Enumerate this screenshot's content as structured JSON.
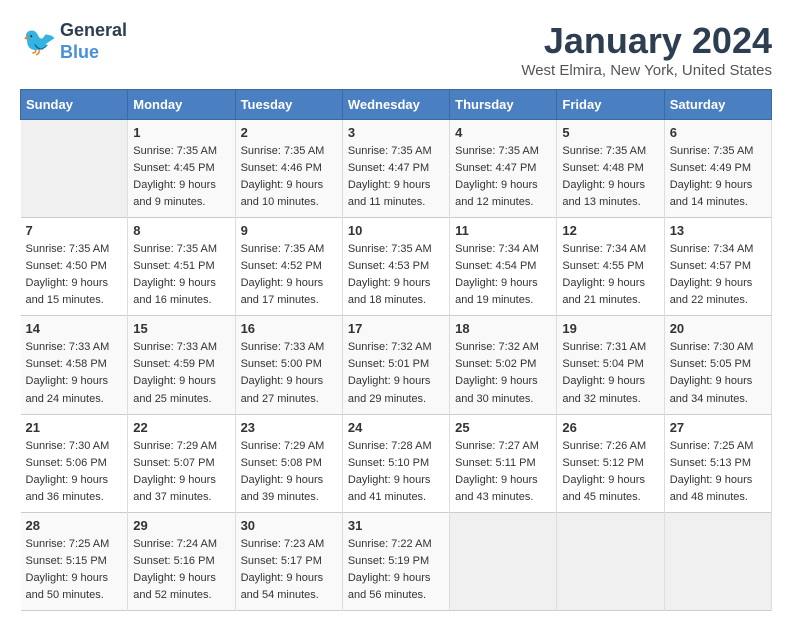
{
  "header": {
    "logo_line1": "General",
    "logo_line2": "Blue",
    "month": "January 2024",
    "location": "West Elmira, New York, United States"
  },
  "weekdays": [
    "Sunday",
    "Monday",
    "Tuesday",
    "Wednesday",
    "Thursday",
    "Friday",
    "Saturday"
  ],
  "weeks": [
    [
      {
        "day": "",
        "info": ""
      },
      {
        "day": "1",
        "info": "Sunrise: 7:35 AM\nSunset: 4:45 PM\nDaylight: 9 hours\nand 9 minutes."
      },
      {
        "day": "2",
        "info": "Sunrise: 7:35 AM\nSunset: 4:46 PM\nDaylight: 9 hours\nand 10 minutes."
      },
      {
        "day": "3",
        "info": "Sunrise: 7:35 AM\nSunset: 4:47 PM\nDaylight: 9 hours\nand 11 minutes."
      },
      {
        "day": "4",
        "info": "Sunrise: 7:35 AM\nSunset: 4:47 PM\nDaylight: 9 hours\nand 12 minutes."
      },
      {
        "day": "5",
        "info": "Sunrise: 7:35 AM\nSunset: 4:48 PM\nDaylight: 9 hours\nand 13 minutes."
      },
      {
        "day": "6",
        "info": "Sunrise: 7:35 AM\nSunset: 4:49 PM\nDaylight: 9 hours\nand 14 minutes."
      }
    ],
    [
      {
        "day": "7",
        "info": "Sunrise: 7:35 AM\nSunset: 4:50 PM\nDaylight: 9 hours\nand 15 minutes."
      },
      {
        "day": "8",
        "info": "Sunrise: 7:35 AM\nSunset: 4:51 PM\nDaylight: 9 hours\nand 16 minutes."
      },
      {
        "day": "9",
        "info": "Sunrise: 7:35 AM\nSunset: 4:52 PM\nDaylight: 9 hours\nand 17 minutes."
      },
      {
        "day": "10",
        "info": "Sunrise: 7:35 AM\nSunset: 4:53 PM\nDaylight: 9 hours\nand 18 minutes."
      },
      {
        "day": "11",
        "info": "Sunrise: 7:34 AM\nSunset: 4:54 PM\nDaylight: 9 hours\nand 19 minutes."
      },
      {
        "day": "12",
        "info": "Sunrise: 7:34 AM\nSunset: 4:55 PM\nDaylight: 9 hours\nand 21 minutes."
      },
      {
        "day": "13",
        "info": "Sunrise: 7:34 AM\nSunset: 4:57 PM\nDaylight: 9 hours\nand 22 minutes."
      }
    ],
    [
      {
        "day": "14",
        "info": "Sunrise: 7:33 AM\nSunset: 4:58 PM\nDaylight: 9 hours\nand 24 minutes."
      },
      {
        "day": "15",
        "info": "Sunrise: 7:33 AM\nSunset: 4:59 PM\nDaylight: 9 hours\nand 25 minutes."
      },
      {
        "day": "16",
        "info": "Sunrise: 7:33 AM\nSunset: 5:00 PM\nDaylight: 9 hours\nand 27 minutes."
      },
      {
        "day": "17",
        "info": "Sunrise: 7:32 AM\nSunset: 5:01 PM\nDaylight: 9 hours\nand 29 minutes."
      },
      {
        "day": "18",
        "info": "Sunrise: 7:32 AM\nSunset: 5:02 PM\nDaylight: 9 hours\nand 30 minutes."
      },
      {
        "day": "19",
        "info": "Sunrise: 7:31 AM\nSunset: 5:04 PM\nDaylight: 9 hours\nand 32 minutes."
      },
      {
        "day": "20",
        "info": "Sunrise: 7:30 AM\nSunset: 5:05 PM\nDaylight: 9 hours\nand 34 minutes."
      }
    ],
    [
      {
        "day": "21",
        "info": "Sunrise: 7:30 AM\nSunset: 5:06 PM\nDaylight: 9 hours\nand 36 minutes."
      },
      {
        "day": "22",
        "info": "Sunrise: 7:29 AM\nSunset: 5:07 PM\nDaylight: 9 hours\nand 37 minutes."
      },
      {
        "day": "23",
        "info": "Sunrise: 7:29 AM\nSunset: 5:08 PM\nDaylight: 9 hours\nand 39 minutes."
      },
      {
        "day": "24",
        "info": "Sunrise: 7:28 AM\nSunset: 5:10 PM\nDaylight: 9 hours\nand 41 minutes."
      },
      {
        "day": "25",
        "info": "Sunrise: 7:27 AM\nSunset: 5:11 PM\nDaylight: 9 hours\nand 43 minutes."
      },
      {
        "day": "26",
        "info": "Sunrise: 7:26 AM\nSunset: 5:12 PM\nDaylight: 9 hours\nand 45 minutes."
      },
      {
        "day": "27",
        "info": "Sunrise: 7:25 AM\nSunset: 5:13 PM\nDaylight: 9 hours\nand 48 minutes."
      }
    ],
    [
      {
        "day": "28",
        "info": "Sunrise: 7:25 AM\nSunset: 5:15 PM\nDaylight: 9 hours\nand 50 minutes."
      },
      {
        "day": "29",
        "info": "Sunrise: 7:24 AM\nSunset: 5:16 PM\nDaylight: 9 hours\nand 52 minutes."
      },
      {
        "day": "30",
        "info": "Sunrise: 7:23 AM\nSunset: 5:17 PM\nDaylight: 9 hours\nand 54 minutes."
      },
      {
        "day": "31",
        "info": "Sunrise: 7:22 AM\nSunset: 5:19 PM\nDaylight: 9 hours\nand 56 minutes."
      },
      {
        "day": "",
        "info": ""
      },
      {
        "day": "",
        "info": ""
      },
      {
        "day": "",
        "info": ""
      }
    ]
  ]
}
